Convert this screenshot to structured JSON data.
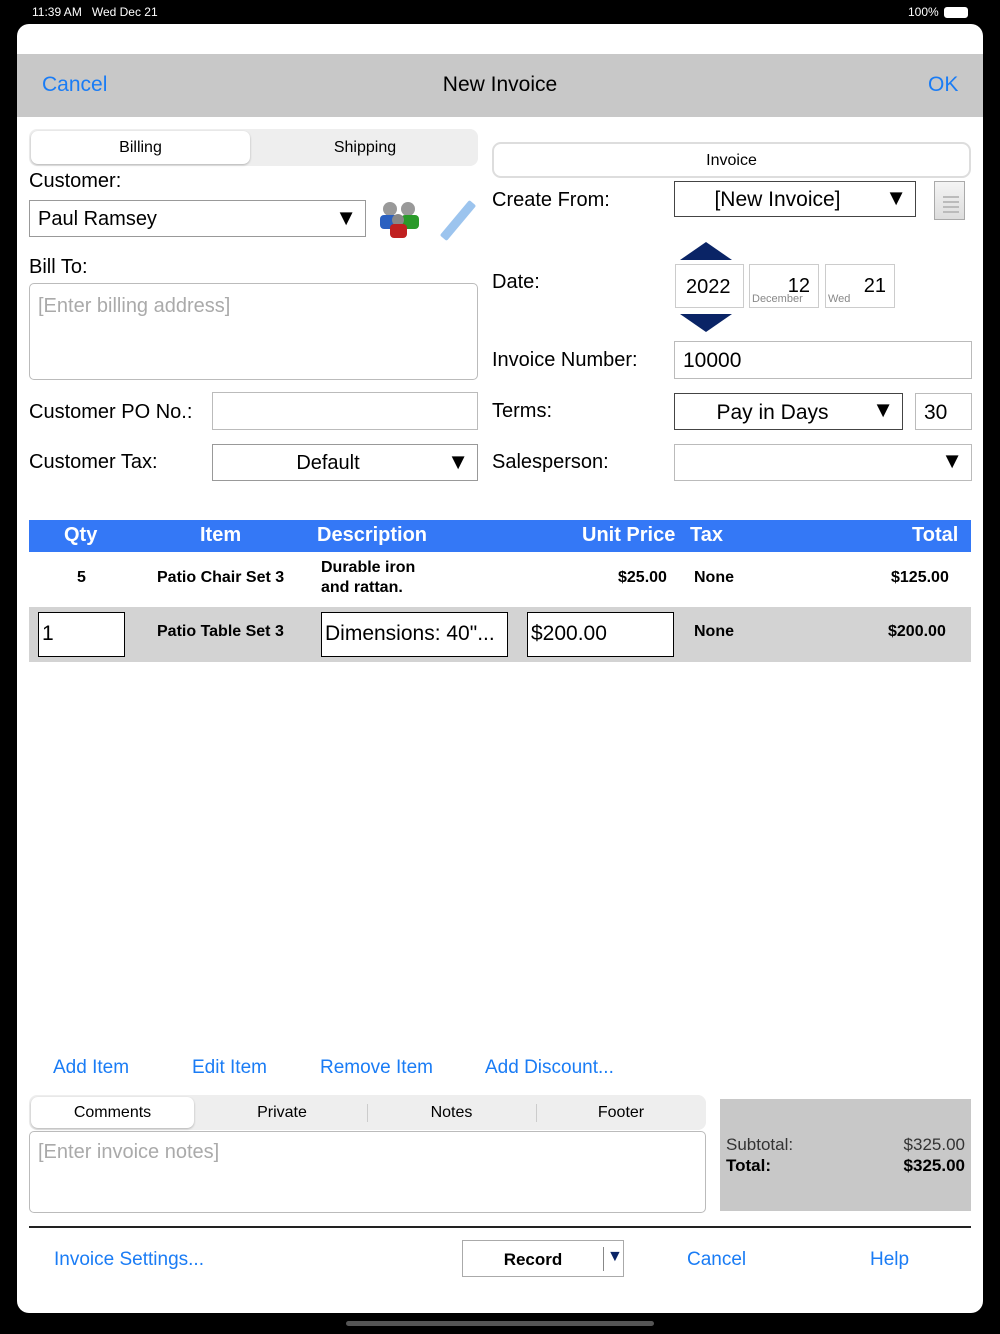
{
  "status": {
    "time": "11:39 AM",
    "date": "Wed Dec 21",
    "battery": "100%"
  },
  "header": {
    "cancel": "Cancel",
    "title": "New Invoice",
    "ok": "OK"
  },
  "left_tabs": [
    "Billing",
    "Shipping"
  ],
  "right_tab": "Invoice",
  "customer": {
    "label": "Customer:",
    "value": "Paul Ramsey"
  },
  "bill_to": {
    "label": "Bill To:",
    "placeholder": "[Enter billing address]"
  },
  "po": {
    "label": "Customer PO No.:",
    "value": ""
  },
  "tax": {
    "label": "Customer Tax:",
    "value": "Default"
  },
  "create_from": {
    "label": "Create From:",
    "value": "[New Invoice]"
  },
  "date": {
    "label": "Date:",
    "year": "2022",
    "month": "12",
    "month_name": "December",
    "day": "21",
    "weekday": "Wed"
  },
  "invoice_number": {
    "label": "Invoice Number:",
    "value": "10000"
  },
  "terms": {
    "label": "Terms:",
    "value": "Pay in Days",
    "days": "30"
  },
  "salesperson": {
    "label": "Salesperson:",
    "value": ""
  },
  "table": {
    "headers": [
      "Qty",
      "Item",
      "Description",
      "Unit Price",
      "Tax",
      "Total"
    ],
    "rows": [
      {
        "qty": "5",
        "item": "Patio Chair Set 3",
        "desc1": "Durable iron",
        "desc2": "and rattan.",
        "price": "$25.00",
        "tax": "None",
        "total": "$125.00"
      },
      {
        "qty": "1",
        "item": "Patio Table Set 3",
        "desc": "Dimensions: 40\"...",
        "price": "$200.00",
        "tax": "None",
        "total": "$200.00"
      }
    ]
  },
  "actions": [
    "Add Item",
    "Edit Item",
    "Remove Item",
    "Add Discount..."
  ],
  "notes_tabs": [
    "Comments",
    "Private",
    "Notes",
    "Footer"
  ],
  "notes": {
    "placeholder": "[Enter invoice notes]"
  },
  "totals": {
    "subtotal_label": "Subtotal:",
    "subtotal": "$325.00",
    "total_label": "Total:",
    "total": "$325.00"
  },
  "footer": {
    "settings": "Invoice Settings...",
    "record": "Record",
    "cancel": "Cancel",
    "help": "Help"
  },
  "colors": {
    "accent": "#1a7cf5",
    "table_header": "#3478f6",
    "date_arrow": "#0a2466"
  }
}
